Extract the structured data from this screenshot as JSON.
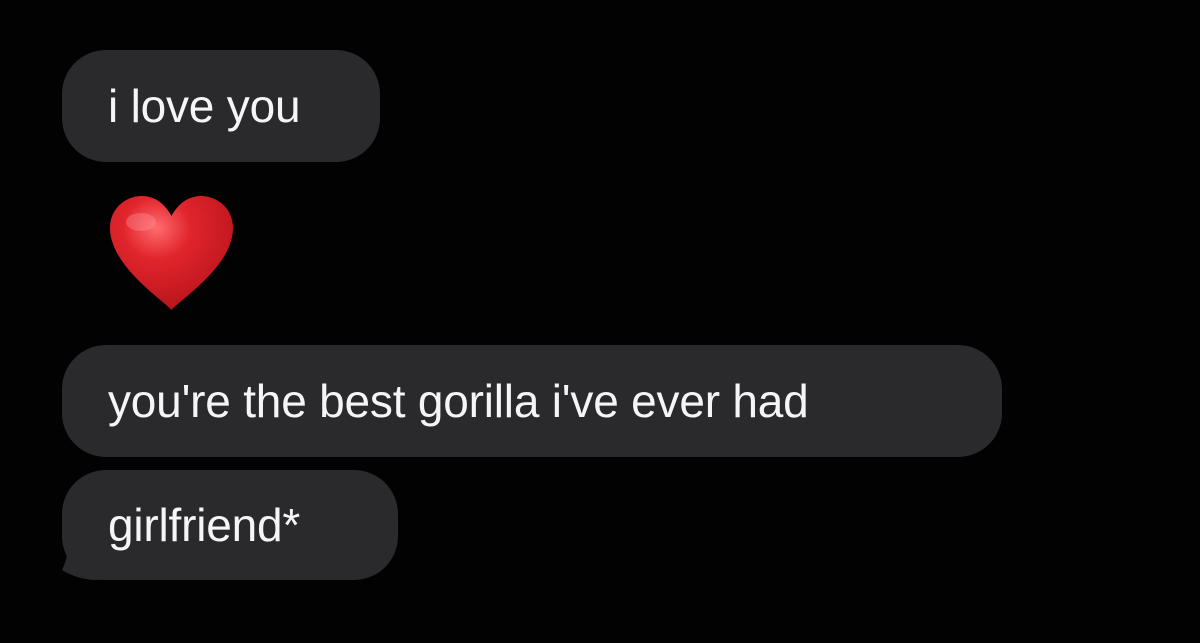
{
  "conversation": {
    "messages": [
      {
        "type": "text",
        "text": "i love you"
      },
      {
        "type": "emoji",
        "icon": "red-heart-icon",
        "color": "#d8232a"
      },
      {
        "type": "text",
        "text": "you're the best gorilla i've ever had"
      },
      {
        "type": "text",
        "text": "girlfriend*"
      }
    ]
  },
  "colors": {
    "background": "#020202",
    "bubble": "#2a2a2c",
    "text": "#f5f5f7",
    "heart": "#d8232a"
  }
}
